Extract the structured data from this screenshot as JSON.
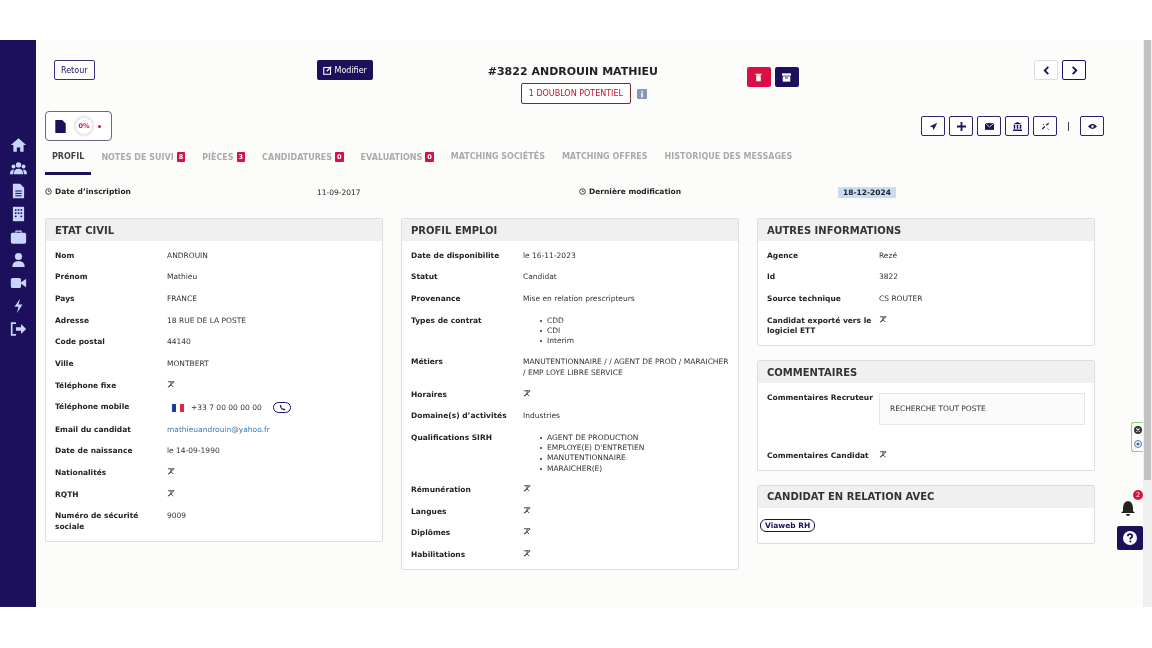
{
  "header": {
    "back_button": "Retour",
    "edit_button": "Modifier",
    "title": "#3822 ANDROUIN MATHIEU",
    "duplicate_badge": "1 DOUBLON POTENTIEL"
  },
  "completion": {
    "reading": "0%",
    "level": 0
  },
  "tabs": [
    {
      "label": "PROFIL",
      "selected": true
    },
    {
      "label": "NOTES DE SUIVI",
      "count": "8",
      "selected": false
    },
    {
      "label": "PIÈCES",
      "count": "3",
      "selected": false
    },
    {
      "label": "CANDIDATURES",
      "count": "0",
      "selected": false
    },
    {
      "label": "EVALUATIONS",
      "count": "0",
      "selected": false
    },
    {
      "label": "MATCHING SOCIÉTÉS",
      "selected": false
    },
    {
      "label": "MATCHING OFFRES",
      "selected": false
    },
    {
      "label": "HISTORIQUE DES MESSAGES",
      "selected": false
    }
  ],
  "dates": [
    {
      "label": "Date d’inscription",
      "value": "11-09-2017",
      "highlighted": false
    },
    {
      "label": "Dernière modification",
      "value": "18-12-2024",
      "highlighted": true
    }
  ],
  "columns": [
    [
      {
        "title": "ETAT CIVIL",
        "fields": [
          {
            "label": "Nom",
            "kind": "text",
            "value": "ANDROUIN"
          },
          {
            "label": "Prénom",
            "kind": "text",
            "value": "Mathieu"
          },
          {
            "label": "Pays",
            "kind": "text",
            "value": "FRANCE"
          },
          {
            "label": "Adresse",
            "kind": "text",
            "value": "18 RUE DE LA POSTE"
          },
          {
            "label": "Code postal",
            "kind": "text",
            "value": "44140"
          },
          {
            "label": "Ville",
            "kind": "text",
            "value": "MONTBERT"
          },
          {
            "label": "Téléphone fixe",
            "kind": "empty"
          },
          {
            "label": "Téléphone mobile",
            "kind": "phone",
            "value": "+33  7 00 00 00 00"
          },
          {
            "label": "Email du candidat",
            "kind": "email",
            "value": "mathieuandrouin@yahoo.fr"
          },
          {
            "label": "Date de naissance",
            "kind": "text",
            "value": "le 14-09-1990"
          },
          {
            "label": "Nationalités",
            "kind": "empty"
          },
          {
            "label": "RQTH",
            "kind": "empty"
          },
          {
            "label": "Numéro de sécurité sociale",
            "kind": "text",
            "value": "9009"
          }
        ]
      }
    ],
    [
      {
        "title": "PROFIL EMPLOI",
        "fields": [
          {
            "label": "Date de disponibilite",
            "kind": "text",
            "value": "le 16-11-2023"
          },
          {
            "label": "Statut",
            "kind": "text",
            "value": "Candidat"
          },
          {
            "label": "Provenance",
            "kind": "text",
            "value": "Mise en relation prescripteurs"
          },
          {
            "label": "Types de contrat",
            "kind": "list",
            "items": [
              "CDD",
              "CDI",
              "Interim"
            ]
          },
          {
            "label": "Métiers",
            "kind": "text",
            "value": "MANUTENTIONNAIRE / / AGENT DE PROD / MARAICHER / EMP LOYE LIBRE SERVICE"
          },
          {
            "label": "Horaires",
            "kind": "empty"
          },
          {
            "label": "Domaine(s) d’activités",
            "kind": "text",
            "value": "Industries"
          },
          {
            "label": "Qualifications SIRH",
            "kind": "list",
            "items": [
              "AGENT DE PRODUCTION",
              "EMPLOYE(E) D'ENTRETIEN",
              "MANUTENTIONNAIRE",
              "MARAICHER(E)"
            ]
          },
          {
            "label": "Rémunération",
            "kind": "empty"
          },
          {
            "label": "Langues",
            "kind": "empty"
          },
          {
            "label": "Diplômes",
            "kind": "empty"
          },
          {
            "label": "Habilitations",
            "kind": "empty"
          }
        ]
      }
    ],
    [
      {
        "title": "AUTRES INFORMATIONS",
        "fields": [
          {
            "label": "Agence",
            "kind": "text",
            "value": "Rezé"
          },
          {
            "label": "Id",
            "kind": "text",
            "value": "3822"
          },
          {
            "label": "Source technique",
            "kind": "text",
            "value": "CS ROUTER"
          },
          {
            "label": "Candidat exporté vers le logiciel ETT",
            "kind": "empty"
          }
        ]
      },
      {
        "title": "COMMENTAIRES",
        "fields": [
          {
            "label": "Commentaires Recruteur",
            "kind": "note",
            "value": "RECHERCHE TOUT POSTE"
          },
          {
            "label": "Commentaires Candidat",
            "kind": "empty"
          }
        ]
      },
      {
        "title": "CANDIDAT EN RELATION AVEC",
        "tags": [
          "Viaweb RH"
        ]
      }
    ]
  ],
  "notifications": {
    "count": "2"
  }
}
